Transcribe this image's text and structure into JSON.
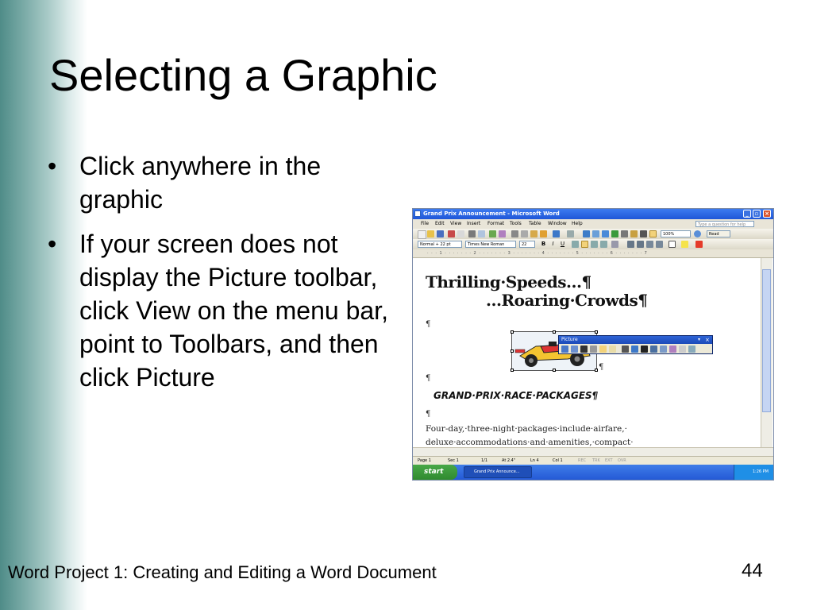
{
  "slide": {
    "title": "Selecting a Graphic",
    "bullets": [
      "Click anywhere in the graphic",
      "If your screen does not display the Picture toolbar, click View on the menu bar, point to Toolbars, and then click Picture"
    ],
    "footer": "Word Project 1: Creating and Editing a Word Document",
    "page_number": "44"
  },
  "word": {
    "window_title": "Grand Prix Announcement - Microsoft Word",
    "menu": [
      "File",
      "Edit",
      "View",
      "Insert",
      "Format",
      "Tools",
      "Table",
      "Window",
      "Help"
    ],
    "help_placeholder": "Type a question for help",
    "zoom": "100%",
    "read_label": "Read",
    "style": "Normal + 22 pt",
    "font": "Times New Roman",
    "size": "22",
    "ruler_text": "· · · 1 · · · · · · · 2 · · · · · · · 3 · · · · · · · 4 · · · · · · · 5 · · · · · · · 6 · · · · · · · 7",
    "doc": {
      "line1": "Thrilling·Speeds…¶",
      "line2": "…Roaring·Crowds¶",
      "pilcrow": "¶",
      "heading": "GRAND·PRIX·RACE·PACKAGES¶",
      "body1": "Four-day,·three-night·packages·include·airfare,·",
      "body2": "deluxe·accommodations·and·amenities,·compact·"
    },
    "picture_toolbar_title": "Picture",
    "status": {
      "page": "Page 1",
      "sec": "Sec 1",
      "pages": "1/1",
      "at": "At 2.4\"",
      "ln": "Ln 4",
      "col": "Col 1",
      "rec": "REC",
      "trk": "TRK",
      "ext": "EXT",
      "ovr": "OVR"
    },
    "taskbar": {
      "start": "start",
      "item": "Grand Prix Announce...",
      "clock": "1:26 PM"
    }
  },
  "colors": {
    "side_gradient": "#4f8c88",
    "titlebar": "#2459d6",
    "start_button": "#3c9a3c"
  }
}
